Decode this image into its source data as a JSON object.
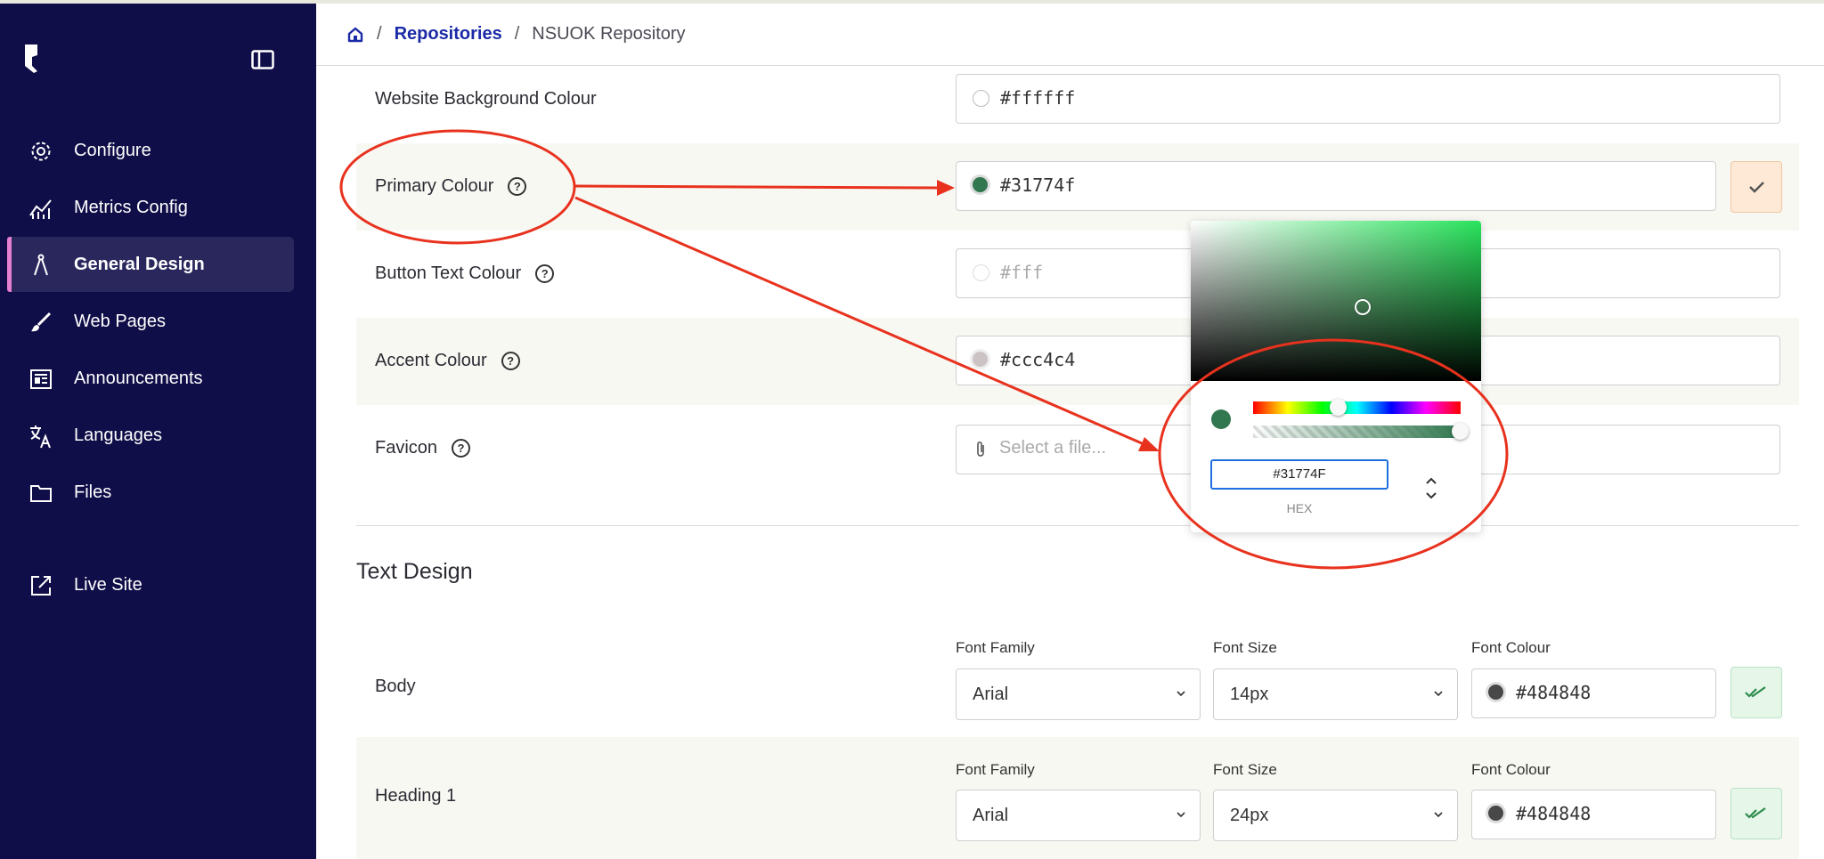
{
  "breadcrumb": {
    "home_icon": "home-icon",
    "repositories": "Repositories",
    "current": "NSUOK Repository"
  },
  "sidebar": {
    "items": [
      {
        "label": "Configure",
        "icon": "gear-icon"
      },
      {
        "label": "Metrics Config",
        "icon": "chart-icon"
      },
      {
        "label": "General Design",
        "icon": "compass-icon",
        "active": true
      },
      {
        "label": "Web Pages",
        "icon": "brush-icon"
      },
      {
        "label": "Announcements",
        "icon": "newspaper-icon"
      },
      {
        "label": "Languages",
        "icon": "translate-icon"
      },
      {
        "label": "Files",
        "icon": "folder-icon"
      },
      {
        "label": "Live Site",
        "icon": "external-link-icon"
      }
    ]
  },
  "colors": {
    "website_bg": {
      "label": "Website Background Colour",
      "value": "#ffffff",
      "swatch": "#ffffff"
    },
    "primary": {
      "label": "Primary Colour",
      "value": "#31774f",
      "swatch": "#31774f"
    },
    "button_text": {
      "label": "Button Text Colour",
      "value": "#fff",
      "swatch": "#ffffff"
    },
    "accent": {
      "label": "Accent Colour",
      "value": "#ccc4c4",
      "swatch": "#ccc4c4"
    },
    "favicon": {
      "label": "Favicon",
      "placeholder": "Select a file..."
    }
  },
  "picker": {
    "hex_value": "#31774F",
    "hex_label": "HEX",
    "color": "#31774f"
  },
  "text_design": {
    "title": "Text Design",
    "rows": [
      {
        "label": "Body",
        "font_family_label": "Font Family",
        "font_family": "Arial",
        "font_size_label": "Font Size",
        "font_size": "14px",
        "font_colour_label": "Font Colour",
        "font_colour": "#484848"
      },
      {
        "label": "Heading 1",
        "font_family_label": "Font Family",
        "font_family": "Arial",
        "font_size_label": "Font Size",
        "font_size": "24px",
        "font_colour_label": "Font Colour",
        "font_colour": "#484848"
      }
    ]
  },
  "theme": {
    "sidebar_bg": "#100e48",
    "active_accent": "#e57fd1",
    "link": "#1b2aa6",
    "annotation_red": "#e8321e"
  }
}
